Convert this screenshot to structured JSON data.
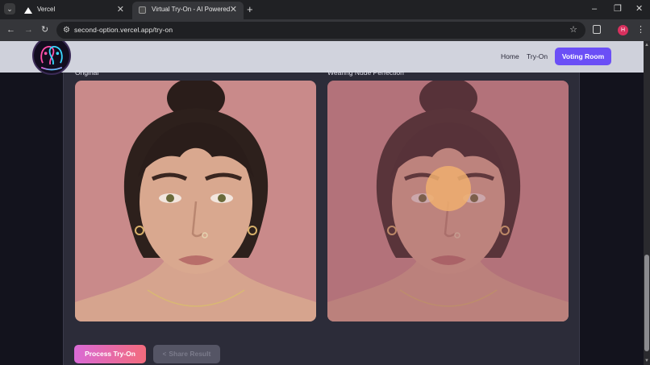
{
  "browser": {
    "tabs": [
      {
        "title": "Vercel",
        "active": false,
        "favicon": "vercel-triangle-icon"
      },
      {
        "title": "Virtual Try-On - AI Powered",
        "active": true,
        "favicon": "app-icon"
      }
    ],
    "new_tab": "+",
    "window_controls": {
      "minimize": "–",
      "restore": "❐",
      "close": "✕"
    },
    "nav": {
      "back": "←",
      "forward": "→",
      "reload": "↻"
    },
    "url": "second-option.vercel.app/try-on",
    "profile_initial": "H"
  },
  "site": {
    "nav_links": [
      "Home",
      "Try-On"
    ],
    "voting_button": "Voting Room",
    "accent_color": "#6b4ff6"
  },
  "main": {
    "original_label": "Original",
    "result_label": "Wearing Nude Perfection",
    "process_button": "Process Try-On",
    "share_button": "Share Result",
    "share_disabled": true
  }
}
